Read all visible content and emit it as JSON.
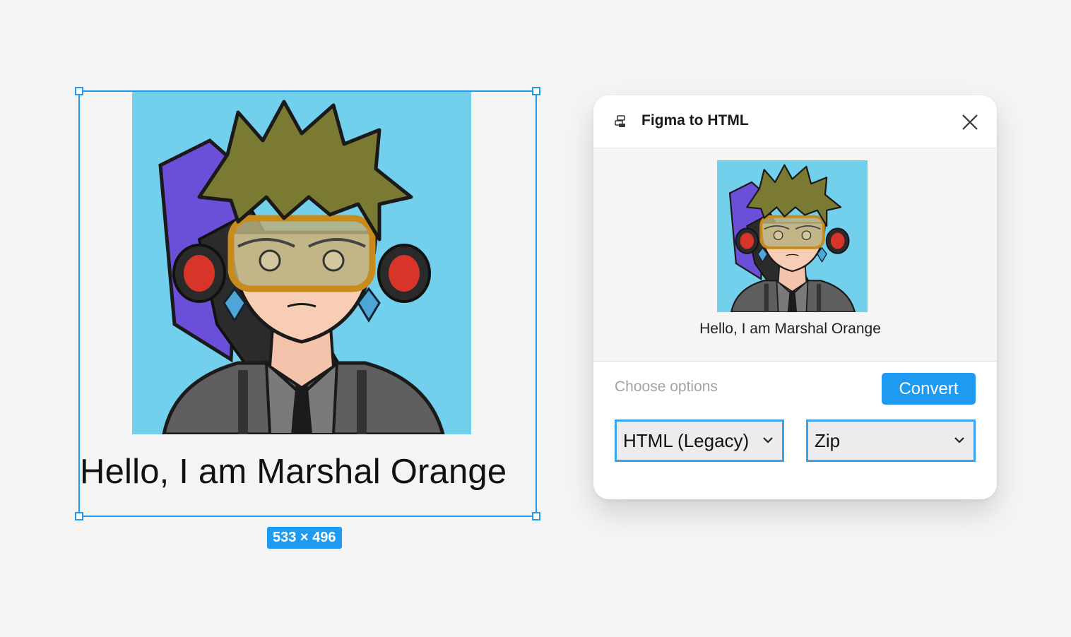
{
  "canvas": {
    "caption": "Hello, I am Marshal Orange",
    "size_badge": "533 × 496",
    "image_name": "avatar-illustration"
  },
  "dialog": {
    "title": "Figma to HTML",
    "icon": "plugin-icon",
    "close_icon": "close-icon",
    "preview_caption": "Hello, I am Marshal Orange",
    "options_label": "Choose options",
    "convert_label": "Convert",
    "format_select": {
      "value": "HTML (Legacy)"
    },
    "output_select": {
      "value": "Zip"
    }
  },
  "colors": {
    "accent": "#1e9bf0",
    "art_background": "#72d0ec",
    "canvas_background": "#f4f4f4"
  }
}
